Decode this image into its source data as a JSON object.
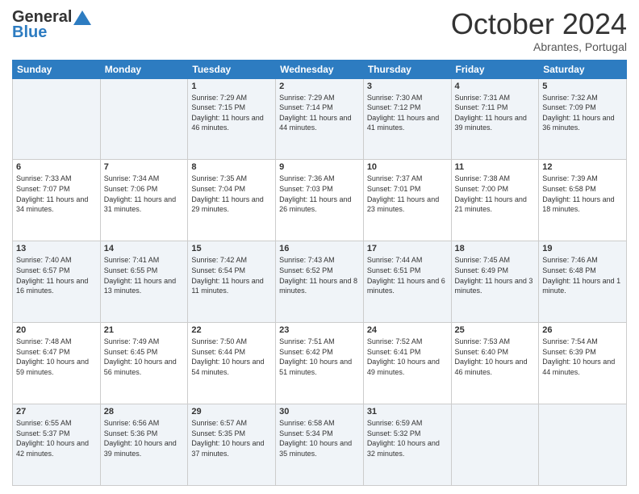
{
  "header": {
    "logo_general": "General",
    "logo_blue": "Blue",
    "month": "October 2024",
    "location": "Abrantes, Portugal"
  },
  "weekdays": [
    "Sunday",
    "Monday",
    "Tuesday",
    "Wednesday",
    "Thursday",
    "Friday",
    "Saturday"
  ],
  "weeks": [
    [
      null,
      null,
      {
        "day": "1",
        "sunrise": "7:29 AM",
        "sunset": "7:15 PM",
        "daylight": "11 hours and 46 minutes."
      },
      {
        "day": "2",
        "sunrise": "7:29 AM",
        "sunset": "7:14 PM",
        "daylight": "11 hours and 44 minutes."
      },
      {
        "day": "3",
        "sunrise": "7:30 AM",
        "sunset": "7:12 PM",
        "daylight": "11 hours and 41 minutes."
      },
      {
        "day": "4",
        "sunrise": "7:31 AM",
        "sunset": "7:11 PM",
        "daylight": "11 hours and 39 minutes."
      },
      {
        "day": "5",
        "sunrise": "7:32 AM",
        "sunset": "7:09 PM",
        "daylight": "11 hours and 36 minutes."
      }
    ],
    [
      {
        "day": "6",
        "sunrise": "7:33 AM",
        "sunset": "7:07 PM",
        "daylight": "11 hours and 34 minutes."
      },
      {
        "day": "7",
        "sunrise": "7:34 AM",
        "sunset": "7:06 PM",
        "daylight": "11 hours and 31 minutes."
      },
      {
        "day": "8",
        "sunrise": "7:35 AM",
        "sunset": "7:04 PM",
        "daylight": "11 hours and 29 minutes."
      },
      {
        "day": "9",
        "sunrise": "7:36 AM",
        "sunset": "7:03 PM",
        "daylight": "11 hours and 26 minutes."
      },
      {
        "day": "10",
        "sunrise": "7:37 AM",
        "sunset": "7:01 PM",
        "daylight": "11 hours and 23 minutes."
      },
      {
        "day": "11",
        "sunrise": "7:38 AM",
        "sunset": "7:00 PM",
        "daylight": "11 hours and 21 minutes."
      },
      {
        "day": "12",
        "sunrise": "7:39 AM",
        "sunset": "6:58 PM",
        "daylight": "11 hours and 18 minutes."
      }
    ],
    [
      {
        "day": "13",
        "sunrise": "7:40 AM",
        "sunset": "6:57 PM",
        "daylight": "11 hours and 16 minutes."
      },
      {
        "day": "14",
        "sunrise": "7:41 AM",
        "sunset": "6:55 PM",
        "daylight": "11 hours and 13 minutes."
      },
      {
        "day": "15",
        "sunrise": "7:42 AM",
        "sunset": "6:54 PM",
        "daylight": "11 hours and 11 minutes."
      },
      {
        "day": "16",
        "sunrise": "7:43 AM",
        "sunset": "6:52 PM",
        "daylight": "11 hours and 8 minutes."
      },
      {
        "day": "17",
        "sunrise": "7:44 AM",
        "sunset": "6:51 PM",
        "daylight": "11 hours and 6 minutes."
      },
      {
        "day": "18",
        "sunrise": "7:45 AM",
        "sunset": "6:49 PM",
        "daylight": "11 hours and 3 minutes."
      },
      {
        "day": "19",
        "sunrise": "7:46 AM",
        "sunset": "6:48 PM",
        "daylight": "11 hours and 1 minute."
      }
    ],
    [
      {
        "day": "20",
        "sunrise": "7:48 AM",
        "sunset": "6:47 PM",
        "daylight": "10 hours and 59 minutes."
      },
      {
        "day": "21",
        "sunrise": "7:49 AM",
        "sunset": "6:45 PM",
        "daylight": "10 hours and 56 minutes."
      },
      {
        "day": "22",
        "sunrise": "7:50 AM",
        "sunset": "6:44 PM",
        "daylight": "10 hours and 54 minutes."
      },
      {
        "day": "23",
        "sunrise": "7:51 AM",
        "sunset": "6:42 PM",
        "daylight": "10 hours and 51 minutes."
      },
      {
        "day": "24",
        "sunrise": "7:52 AM",
        "sunset": "6:41 PM",
        "daylight": "10 hours and 49 minutes."
      },
      {
        "day": "25",
        "sunrise": "7:53 AM",
        "sunset": "6:40 PM",
        "daylight": "10 hours and 46 minutes."
      },
      {
        "day": "26",
        "sunrise": "7:54 AM",
        "sunset": "6:39 PM",
        "daylight": "10 hours and 44 minutes."
      }
    ],
    [
      {
        "day": "27",
        "sunrise": "6:55 AM",
        "sunset": "5:37 PM",
        "daylight": "10 hours and 42 minutes."
      },
      {
        "day": "28",
        "sunrise": "6:56 AM",
        "sunset": "5:36 PM",
        "daylight": "10 hours and 39 minutes."
      },
      {
        "day": "29",
        "sunrise": "6:57 AM",
        "sunset": "5:35 PM",
        "daylight": "10 hours and 37 minutes."
      },
      {
        "day": "30",
        "sunrise": "6:58 AM",
        "sunset": "5:34 PM",
        "daylight": "10 hours and 35 minutes."
      },
      {
        "day": "31",
        "sunrise": "6:59 AM",
        "sunset": "5:32 PM",
        "daylight": "10 hours and 32 minutes."
      },
      null,
      null
    ]
  ]
}
